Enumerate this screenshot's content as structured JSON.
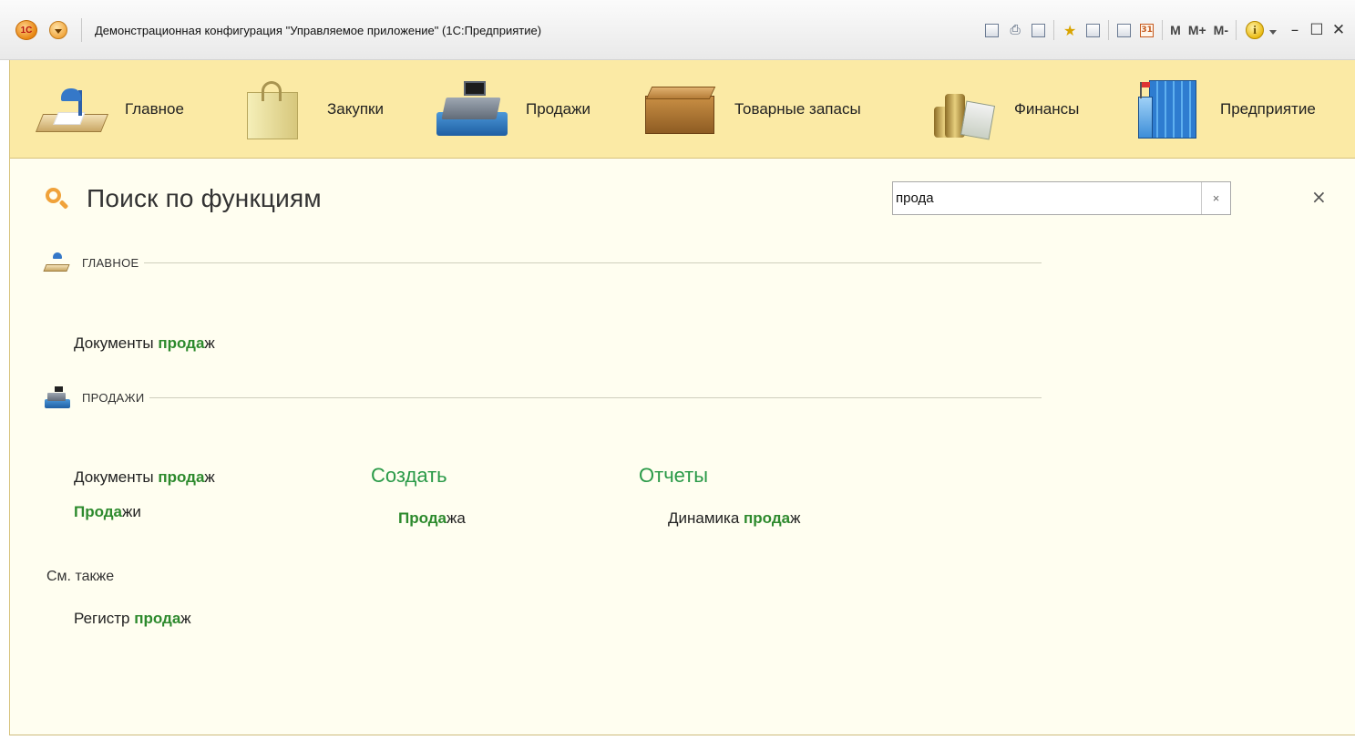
{
  "window": {
    "title": "Демонстрационная конфигурация \"Управляемое приложение\"  (1С:Предприятие)",
    "logo_text": "1С",
    "toolbar": {
      "icons": [
        "save-icon",
        "print-icon",
        "preview-icon",
        "favorites-add-icon",
        "favorites-icon",
        "calculator-icon",
        "calendar-icon",
        "info-icon"
      ],
      "calendar_text": "31",
      "m_label": "M",
      "mplus_label": "M+",
      "mminus_label": "M-",
      "info_label": "i",
      "minimize": "–",
      "maximize": "☐",
      "close": "✕"
    }
  },
  "sections": [
    {
      "label": "Главное",
      "icon": "desk-icon"
    },
    {
      "label": "Закупки",
      "icon": "shopping-bag-icon"
    },
    {
      "label": "Продажи",
      "icon": "cash-register-icon"
    },
    {
      "label": "Товарные запасы",
      "icon": "box-icon"
    },
    {
      "label": "Финансы",
      "icon": "coins-icon"
    },
    {
      "label": "Предприятие",
      "icon": "building-icon"
    }
  ],
  "search": {
    "title": "Поиск по функциям",
    "query": "прода",
    "clear_label": "×",
    "close_label": "×"
  },
  "groups": {
    "main": {
      "name": "Главное",
      "items": [
        {
          "prefix": "Документы ",
          "match": "прода",
          "suffix": "ж"
        }
      ]
    },
    "sales": {
      "name": "Продажи",
      "items": [
        {
          "prefix": "Документы ",
          "match": "прода",
          "suffix": "ж"
        },
        {
          "prefix": "",
          "match": "Прода",
          "suffix": "жи"
        }
      ],
      "create": {
        "header": "Создать",
        "items": [
          {
            "prefix": "",
            "match": "Прода",
            "suffix": "жа"
          }
        ]
      },
      "reports": {
        "header": "Отчеты",
        "items": [
          {
            "prefix": "Динамика ",
            "match": "прода",
            "suffix": "ж"
          }
        ]
      }
    }
  },
  "see_also": {
    "label": "См. также",
    "items": [
      {
        "prefix": "Регистр ",
        "match": "прода",
        "suffix": "ж"
      }
    ]
  },
  "colors": {
    "section_bar": "#fbeaa5",
    "content_bg": "#fffef0",
    "match_green": "#2d8a2d",
    "header_green": "#2a9a48",
    "search_icon_orange": "#f0a23a"
  }
}
